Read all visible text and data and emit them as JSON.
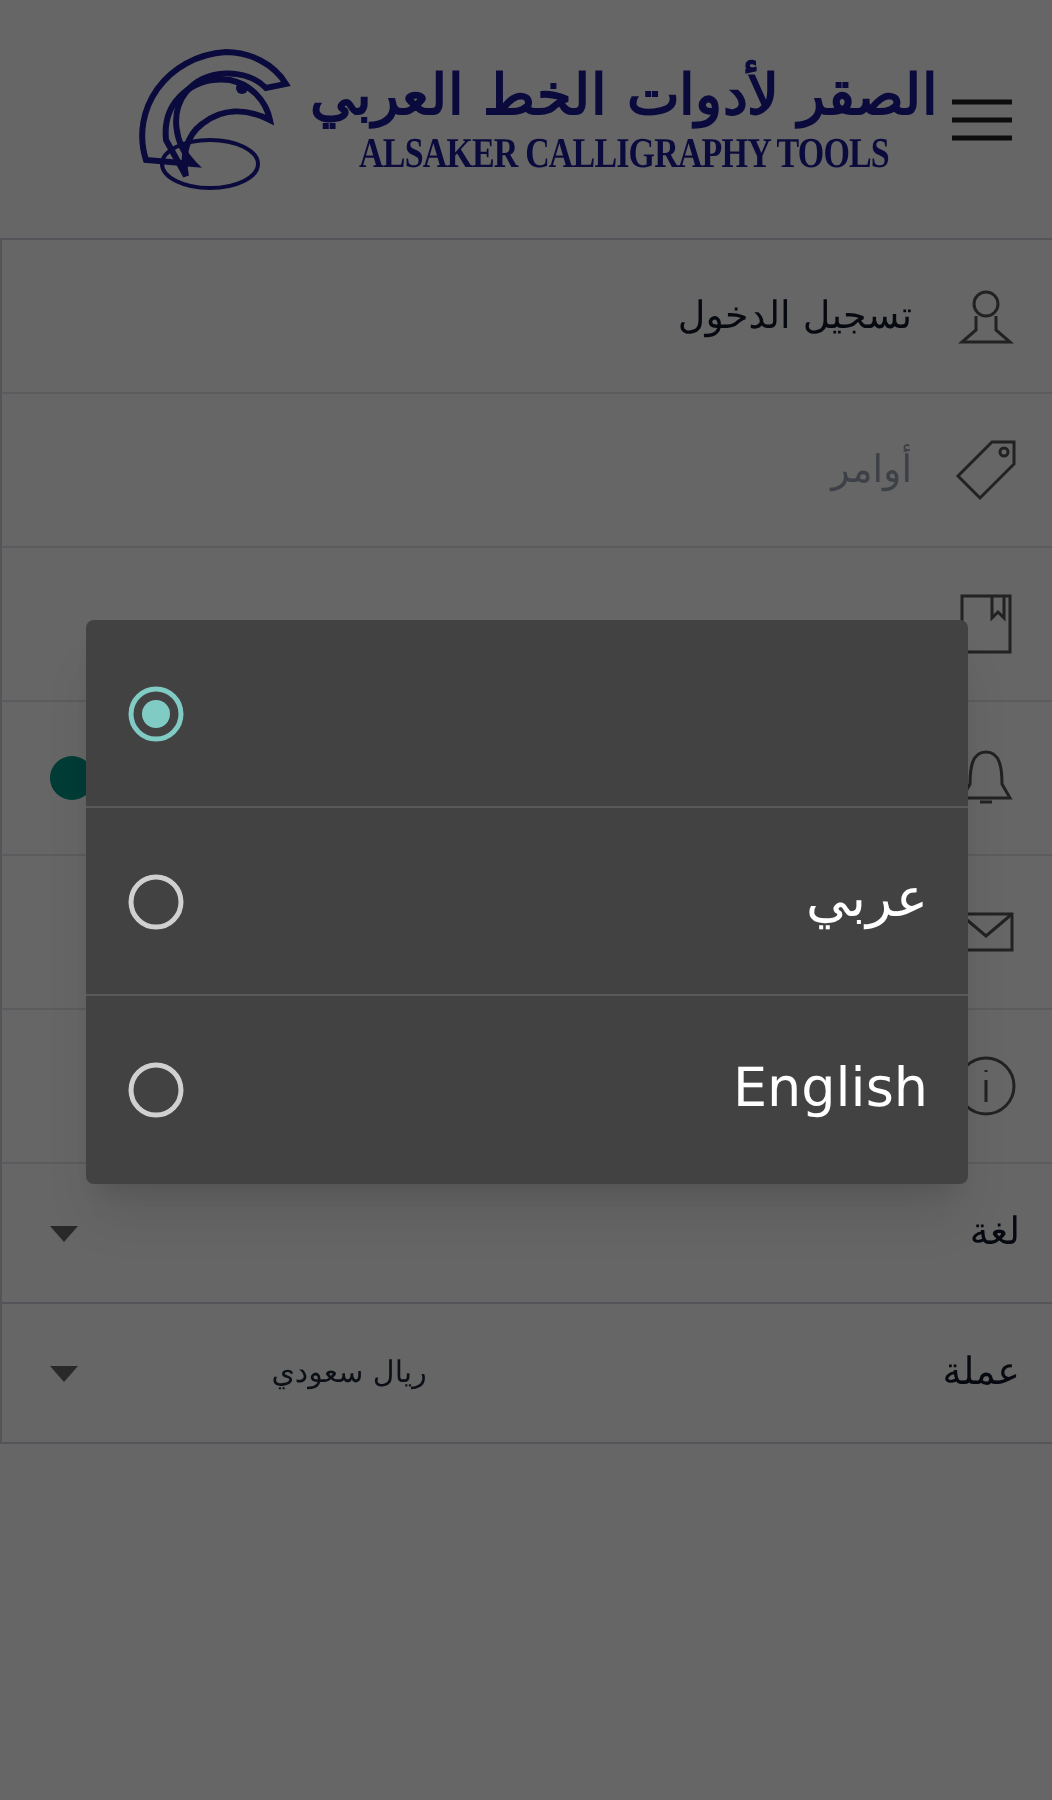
{
  "header": {
    "logo": {
      "arabic": "الصقر لأدوات الخط العربي",
      "latin": "ALSAKER CALLIGRAPHY TOOLS"
    }
  },
  "menu": [
    {
      "kind": "user",
      "label": "تسجيل الدخول",
      "disabled": false
    },
    {
      "kind": "tag",
      "label": "أوامر",
      "disabled": true
    },
    {
      "kind": "book"
    },
    {
      "kind": "bell",
      "toggle": {
        "on": true
      }
    },
    {
      "kind": "mail"
    },
    {
      "kind": "info"
    }
  ],
  "selects": [
    {
      "label": "لغة"
    },
    {
      "label": "عملة",
      "value": "ريال سعودي"
    }
  ],
  "dialog": {
    "options": [
      {
        "selected": true
      },
      {
        "label": "عربي",
        "selected": false
      },
      {
        "label": "English",
        "selected": false
      }
    ]
  }
}
